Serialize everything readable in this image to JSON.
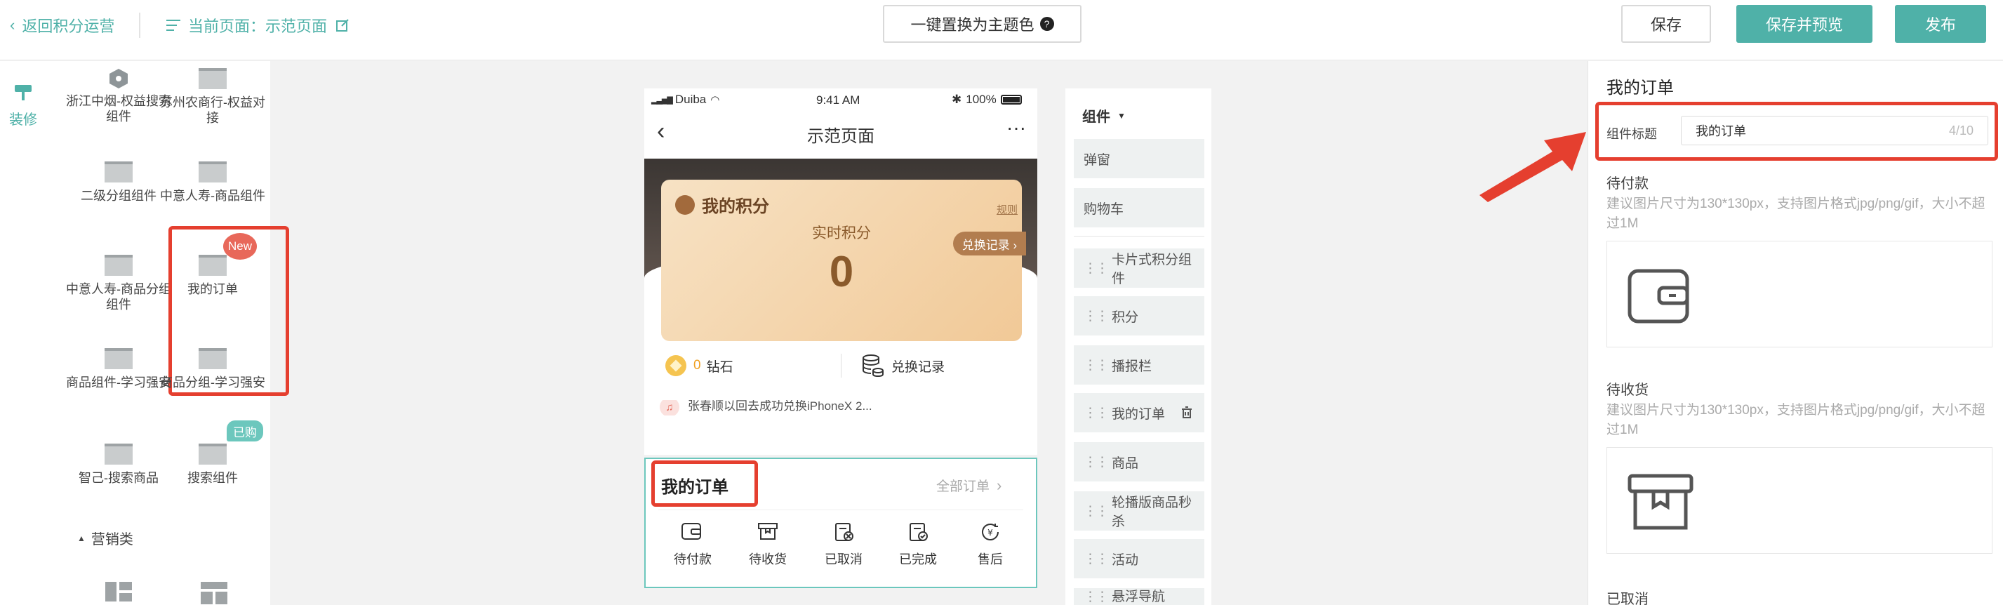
{
  "topbar": {
    "back_label": "返回积分运营",
    "current_page_label": "当前页面：示范页面",
    "theme_button": "一键置换为主题色",
    "save": "保存",
    "save_preview": "保存并预览",
    "publish": "发布"
  },
  "leftbar": {
    "decorate_label": "装修",
    "components": [
      {
        "label": "浙江中烟-权益搜索组件"
      },
      {
        "label": "苏州农商行-权益对接"
      },
      {
        "label": "二级分组组件"
      },
      {
        "label": "中意人寿-商品组件"
      },
      {
        "label": "中意人寿-商品分组组件"
      },
      {
        "label": "我的订单",
        "badge": "New"
      },
      {
        "label": "商品组件-学习强安"
      },
      {
        "label": "商品分组-学习强安",
        "badge": "已购"
      },
      {
        "label": "智己-搜索商品"
      },
      {
        "label": "搜索组件"
      }
    ],
    "section_marketing": "营销类"
  },
  "phone": {
    "carrier": "Duiba",
    "time": "9:41 AM",
    "battery": "100%",
    "nav_title": "示范页面",
    "points_card": {
      "title": "我的积分",
      "rules": "规则",
      "realtime_label": "实时积分",
      "points_value": "0",
      "exchange_badge": "兑换记录 ›"
    },
    "diamond_count": "0",
    "diamond_label": "钻石",
    "exchange_record": "兑换记录",
    "notice_text": "张春顺以回去成功兑换iPhoneX 2...",
    "orders": {
      "title": "我的订单",
      "all_orders": "全部订单",
      "items": [
        {
          "label": "待付款",
          "icon": "wallet-icon"
        },
        {
          "label": "待收货",
          "icon": "box-icon"
        },
        {
          "label": "已取消",
          "icon": "cancelled-doc-icon"
        },
        {
          "label": "已完成",
          "icon": "completed-doc-icon"
        },
        {
          "label": "售后",
          "icon": "after-sale-icon"
        }
      ]
    }
  },
  "complist": {
    "header": "组件",
    "items": [
      "弹窗",
      "购物车",
      "卡片式积分组件",
      "积分",
      "播报栏",
      "我的订单",
      "商品",
      "轮播版商品秒杀",
      "活动",
      "悬浮导航"
    ]
  },
  "rightpanel": {
    "title": "我的订单",
    "field_label": "组件标题",
    "field_value": "我的订单",
    "field_counter": "4/10",
    "section1": "待付款",
    "hint1": "建议图片尺寸为130*130px，支持图片格式jpg/png/gif，大小不超过1M",
    "section2": "待收货",
    "hint2": "建议图片尺寸为130*130px，支持图片格式jpg/png/gif，大小不超过1M",
    "section3": "已取消"
  },
  "colors": {
    "accent": "#4fb1a8",
    "highlight": "#e53f2f",
    "points_brown": "#8a5a2b"
  }
}
